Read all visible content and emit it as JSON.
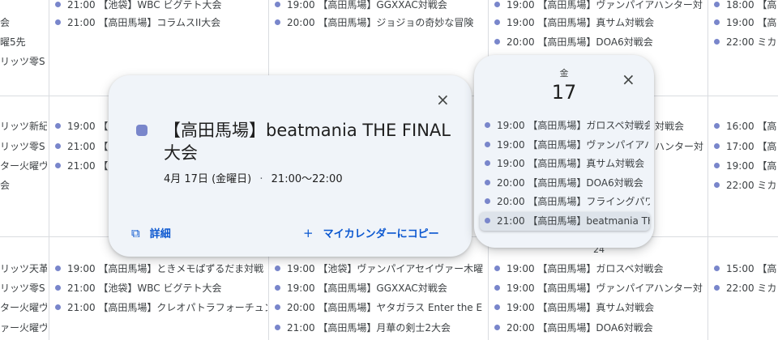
{
  "calendar": {
    "col1": [
      {
        "text": "会"
      },
      {
        "text": "曜5先"
      },
      {
        "text": "リッツ零S"
      },
      {
        "text": "リッツ新紀"
      },
      {
        "text": "リッツ零S"
      },
      {
        "text": "ター火曜ヴ"
      },
      {
        "text": "会"
      },
      {
        "text": "リッツ天革"
      },
      {
        "text": "リッツ零S"
      },
      {
        "text": "ター火曜ヴ"
      },
      {
        "text": "ァー火曜ヴ"
      }
    ],
    "col2": [
      {
        "text": "21:00 【池袋】WBC ビグテト大会"
      },
      {
        "text": "21:00 【高田馬場】コラムスII大会"
      },
      {
        "text": "19:00 【高田馬場】"
      },
      {
        "text": "21:00 【池袋】"
      },
      {
        "text": "21:00 【高田馬場】"
      },
      {
        "text": "19:00 【高田馬場】ときメモぱずるだま対戦"
      },
      {
        "text": "21:00 【池袋】WBC ビグテト大会"
      },
      {
        "text": "21:00 【高田馬場】クレオパトラフォーチュン"
      }
    ],
    "col3": [
      {
        "text": "19:00 【高田馬場】GGXXAC対戦会"
      },
      {
        "text": "20:00 【高田馬場】ジョジョの奇妙な冒険"
      },
      {
        "text": "19:00 【池袋】ヴァンパイアセイヴァー木曜"
      },
      {
        "text": "19:00 【高田馬場】GGXXAC対戦会"
      },
      {
        "text": "20:00 【高田馬場】ヤタガラス Enter the E"
      },
      {
        "text": "21:00 【高田馬場】月華の剣士2大会"
      }
    ],
    "col4": [
      {
        "text": "19:00 【高田馬場】ヴァンパイアハンター対"
      },
      {
        "text": "19:00 【高田馬場】真サム対戦会"
      },
      {
        "text": "20:00 【高田馬場】DOA6対戦会"
      },
      {
        "text": "対戦会"
      },
      {
        "text": "ハンター対"
      },
      {
        "text": "19:00 【高田馬場】ガロスペ対戦会"
      },
      {
        "text": "19:00 【高田馬場】ヴァンパイアハンター対"
      },
      {
        "text": "19:00 【高田馬場】真サム対戦会"
      },
      {
        "text": "20:00 【高田馬場】DOA6対戦会"
      }
    ],
    "col4_daynum": "24",
    "col5": [
      {
        "text": "18:00 【高"
      },
      {
        "text": "19:00 【高"
      },
      {
        "text": "22:00 ミカ"
      },
      {
        "text": "16:00 【高"
      },
      {
        "text": "17:00 【高"
      },
      {
        "text": "19:00 【高"
      },
      {
        "text": "22:00 ミカ"
      },
      {
        "text": "15:00 【高"
      },
      {
        "text": "22:00 ミカ"
      }
    ]
  },
  "event_popup": {
    "title": "【高田馬場】beatmania THE FINAL 大会",
    "date": "4月 17日 (金曜日)",
    "separator": "·",
    "time": "21:00〜22:00",
    "close_icon": "×",
    "details_icon": "⧉",
    "details_label": "詳細",
    "copy_icon": "+",
    "copy_label": "マイカレンダーにコピー",
    "color": "#7986cb"
  },
  "day_popup": {
    "weekday": "金",
    "day": "17",
    "close_icon": "×",
    "events": [
      {
        "text": "19:00 【高田馬場】ガロスペ対戦会"
      },
      {
        "text": "19:00 【高田馬場】ヴァンパイアハンター対"
      },
      {
        "text": "19:00 【高田馬場】真サム対戦会"
      },
      {
        "text": "20:00 【高田馬場】DOA6対戦会"
      },
      {
        "text": "20:00 【高田馬場】フライングパワーディスク"
      },
      {
        "text": "21:00 【高田馬場】beatmania THE FINAL 大会"
      }
    ]
  }
}
